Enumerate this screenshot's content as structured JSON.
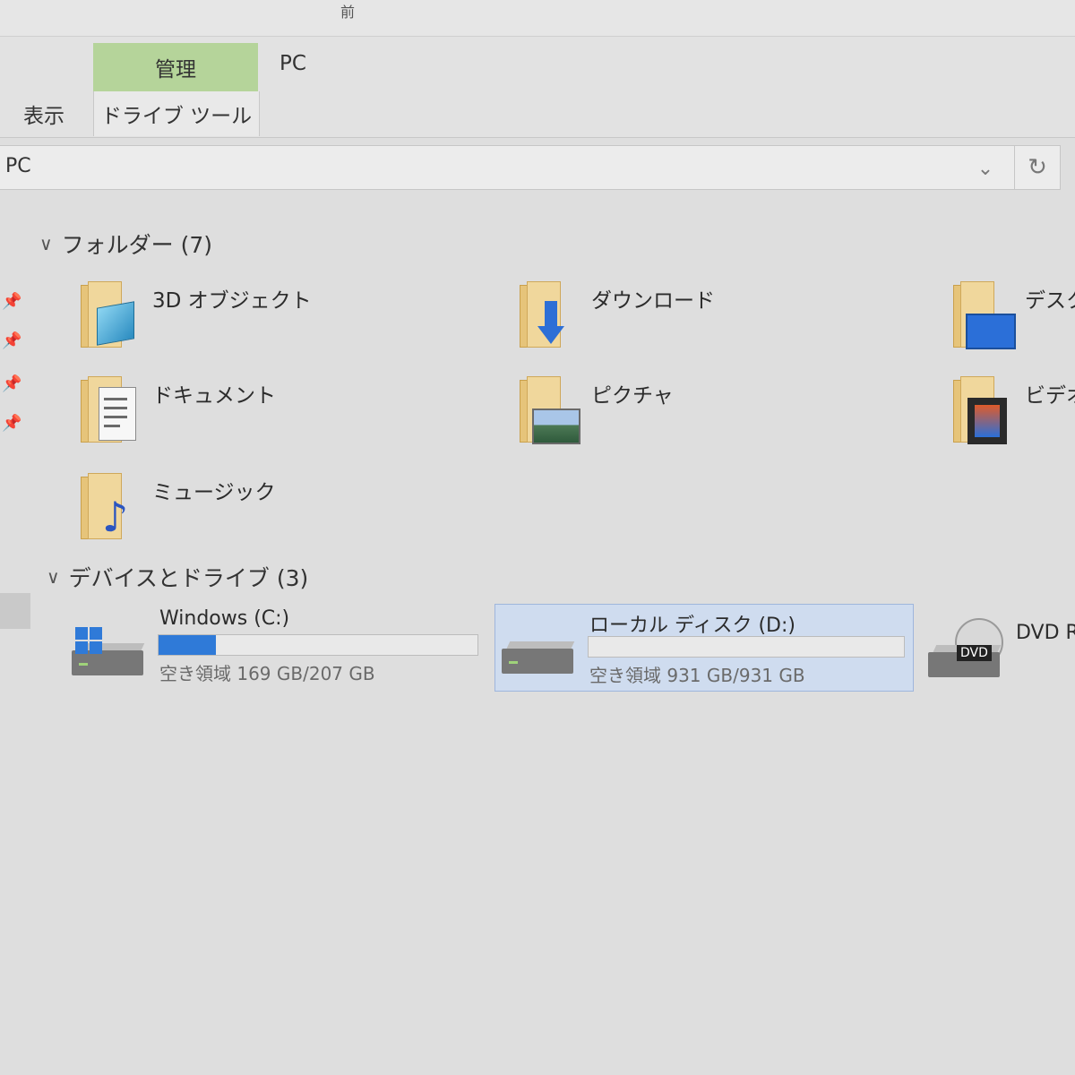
{
  "window": {
    "title_fragment": "前"
  },
  "ribbon": {
    "tabs": [
      {
        "label": "管理"
      },
      {
        "label": "PC"
      },
      {
        "label": "表示"
      },
      {
        "label": "ドライブ ツール"
      }
    ]
  },
  "address_bar": {
    "path": "PC",
    "dropdown_icon": "chevron-down-icon",
    "refresh_icon": "refresh-icon"
  },
  "colors": {
    "manage_tab": "#b5d49a",
    "usage_bar": "#2f7ad8",
    "selection": "#cfdcef"
  },
  "sections": {
    "folders": {
      "title": "フォルダー (7)",
      "items": [
        {
          "label": "3D オブジェクト",
          "icon": "3d-objects-folder-icon"
        },
        {
          "label": "ダウンロード",
          "icon": "downloads-folder-icon"
        },
        {
          "label": "デスク",
          "icon": "desktop-folder-icon"
        },
        {
          "label": "ドキュメント",
          "icon": "documents-folder-icon"
        },
        {
          "label": "ピクチャ",
          "icon": "pictures-folder-icon"
        },
        {
          "label": "ビデオ",
          "icon": "videos-folder-icon"
        },
        {
          "label": "ミュージック",
          "icon": "music-folder-icon"
        }
      ]
    },
    "drives": {
      "title": "デバイスとドライブ (3)",
      "items": [
        {
          "name": "Windows (C:)",
          "free_text": "空き領域 169 GB/207 GB",
          "used_fraction": 0.18,
          "icon": "windows-drive-icon"
        },
        {
          "name": "ローカル ディスク (D:)",
          "free_text": "空き領域 931 GB/931 GB",
          "used_fraction": 0.0,
          "icon": "hard-drive-icon",
          "selected": true
        },
        {
          "name": "DVD R",
          "icon": "dvd-drive-icon"
        }
      ]
    }
  }
}
